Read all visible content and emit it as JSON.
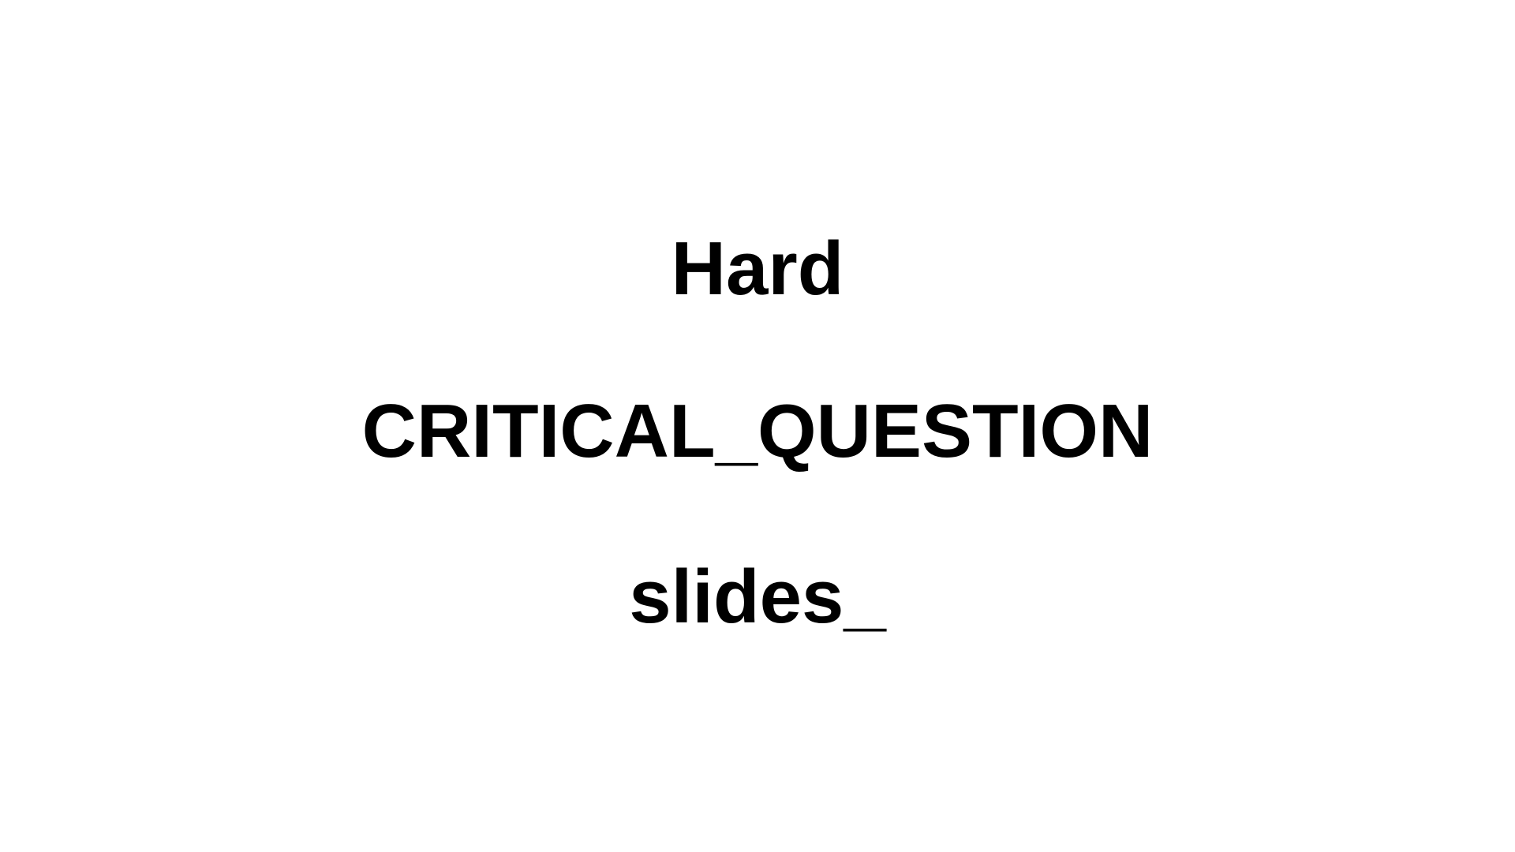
{
  "slide": {
    "lines": [
      "Hard",
      "CRITICAL_QUESTION",
      "slides_"
    ],
    "background_color": "#ffffff",
    "text_color": "#000000"
  }
}
